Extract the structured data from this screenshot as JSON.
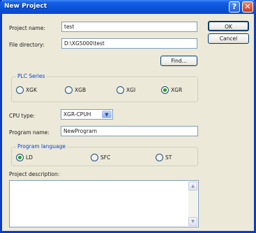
{
  "window": {
    "title": "New Project"
  },
  "titlebar": {
    "help_glyph": "?",
    "close_glyph": "✕"
  },
  "buttons": {
    "ok": "OK",
    "cancel": "Cancel",
    "find": "Find..."
  },
  "project_name": {
    "label": "Project name:",
    "value": "test"
  },
  "file_directory": {
    "label": "File directory:",
    "value": "D:\\XG5000\\test"
  },
  "plc_series": {
    "title": "PLC Series",
    "options": [
      {
        "label": "XGK",
        "selected": false
      },
      {
        "label": "XGB",
        "selected": false
      },
      {
        "label": "XGI",
        "selected": false
      },
      {
        "label": "XGR",
        "selected": true
      }
    ]
  },
  "cpu_type": {
    "label": "CPU type:",
    "value": "XGR-CPUH"
  },
  "program_name": {
    "label": "Program name:",
    "value": "NewProgram"
  },
  "program_language": {
    "title": "Program language",
    "options": [
      {
        "label": "LD",
        "selected": true
      },
      {
        "label": "SFC",
        "selected": false
      },
      {
        "label": "ST",
        "selected": false
      }
    ]
  },
  "project_description": {
    "label": "Project description:",
    "value": ""
  },
  "scrollbar": {
    "up_glyph": "▲",
    "down_glyph": "▼"
  },
  "dropdown_glyph": "▼"
}
